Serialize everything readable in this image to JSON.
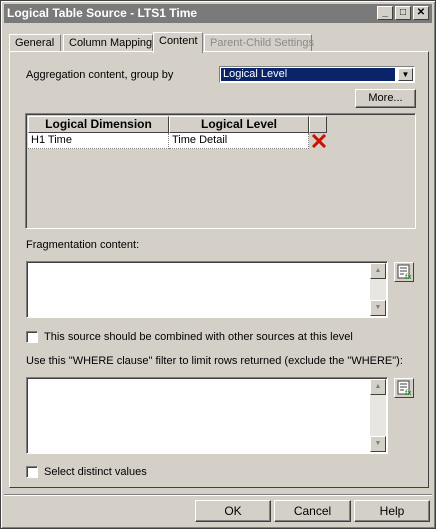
{
  "window": {
    "title": "Logical Table Source - LTS1 Time"
  },
  "titlebar_buttons": {
    "minimize": "_",
    "maximize": "□",
    "close": "✕"
  },
  "tabs": [
    {
      "label": "General"
    },
    {
      "label": "Column Mapping"
    },
    {
      "label": "Content"
    },
    {
      "label": "Parent-Child Settings"
    }
  ],
  "content": {
    "aggregation_label": "Aggregation content, group by",
    "aggregation_value": "Logical Level",
    "more_button": "More...",
    "table": {
      "headers": [
        "Logical Dimension",
        "Logical Level"
      ],
      "rows": [
        {
          "dimension": "H1 Time",
          "level": "Time Detail"
        }
      ]
    },
    "fragmentation_label": "Fragmentation content:",
    "combine_checkbox_label": "This source should be combined with other sources at this level",
    "where_label": "Use this \"WHERE clause\" filter to limit rows returned (exclude the \"WHERE\"):",
    "distinct_checkbox_label": "Select distinct values"
  },
  "footer": {
    "ok": "OK",
    "cancel": "Cancel",
    "help": "Help"
  },
  "icons": {
    "delete": "delete-row-icon",
    "expression": "expression-builder-icon"
  }
}
